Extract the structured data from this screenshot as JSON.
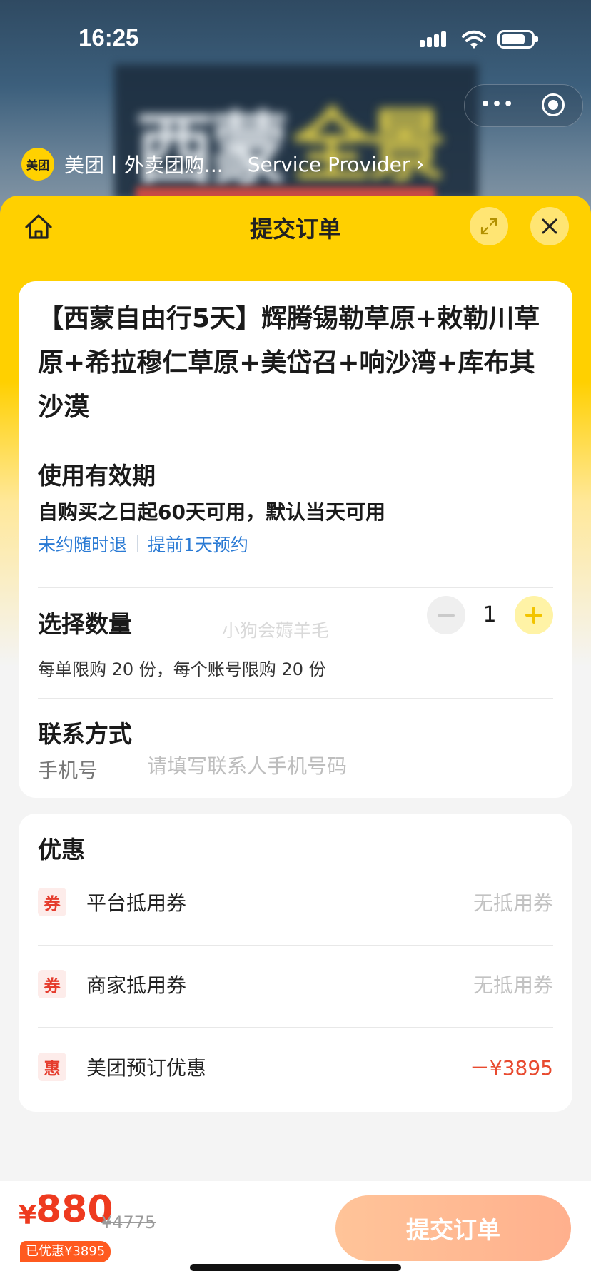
{
  "status_bar": {
    "time": "16:25"
  },
  "provider": {
    "logo_text": "美团",
    "name": "美团丨外卖团购...",
    "link_label": "Service Provider"
  },
  "sheet": {
    "title": "提交订单"
  },
  "product": {
    "title": "【西蒙自由行5天】辉腾锡勒草原+敕勒川草原+希拉穆仁草原+美岱召+响沙湾+库布其沙漠"
  },
  "validity": {
    "title": "使用有效期",
    "text": "自购买之日起60天可用，默认当天可用",
    "tags": [
      "未约随时退",
      "提前1天预约"
    ]
  },
  "quantity": {
    "title": "选择数量",
    "value": "1",
    "limit_text": "每单限购 20 份，每个账号限购 20 份",
    "watermark": "小狗会薅羊毛"
  },
  "contact": {
    "title": "联系方式",
    "phone_label": "手机号",
    "phone_value": "",
    "phone_placeholder": "请填写联系人手机号码"
  },
  "promotions": {
    "title": "优惠",
    "rows": [
      {
        "badge": "券",
        "label": "平台抵用券",
        "value": "无抵用券"
      },
      {
        "badge": "券",
        "label": "商家抵用券",
        "value": "无抵用券"
      },
      {
        "badge": "惠",
        "label": "美团预订优惠",
        "value": "－¥3895"
      }
    ]
  },
  "bottom_bar": {
    "currency": "¥",
    "price_now": "880",
    "price_original": "¥4775",
    "saved_badge": "已优惠¥3895",
    "submit_label": "提交订单"
  },
  "colors": {
    "brand_yellow": "#ffd000",
    "price_red": "#ee3a1f",
    "link_blue": "#2a7ad4",
    "submit_gradient_start": "#ffc499",
    "submit_gradient_end": "#ffb08d"
  },
  "icons": {
    "header_left": "home-icon",
    "header_expand": "expand-icon",
    "header_close": "close-icon",
    "capsule_more": "more-dots-icon",
    "capsule_target": "target-icon"
  }
}
